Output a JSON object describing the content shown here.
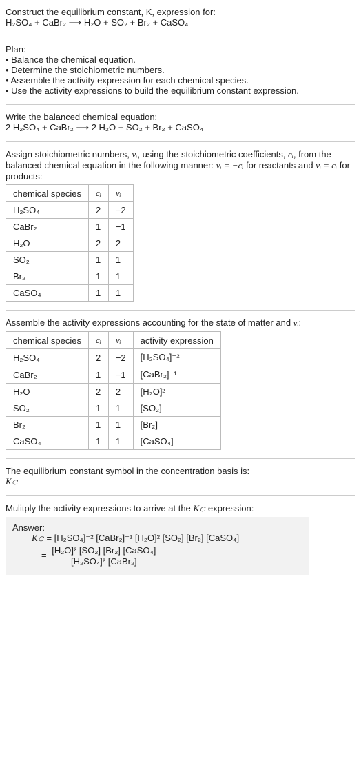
{
  "intro": {
    "line1": "Construct the equilibrium constant, K, expression for:",
    "equation": "H₂SO₄ + CaBr₂ ⟶ H₂O + SO₂ + Br₂ + CaSO₄"
  },
  "plan": {
    "title": "Plan:",
    "items": [
      "• Balance the chemical equation.",
      "• Determine the stoichiometric numbers.",
      "• Assemble the activity expression for each chemical species.",
      "• Use the activity expressions to build the equilibrium constant expression."
    ]
  },
  "balanced": {
    "title": "Write the balanced chemical equation:",
    "equation": "2 H₂SO₄ + CaBr₂ ⟶ 2 H₂O + SO₂ + Br₂ + CaSO₄"
  },
  "assign": {
    "text_a": "Assign stoichiometric numbers, ",
    "nu": "νᵢ",
    "text_b": ", using the stoichiometric coefficients, ",
    "ci": "cᵢ",
    "text_c": ", from the balanced chemical equation in the following manner: ",
    "rule1": "νᵢ = −cᵢ",
    "text_d": " for reactants and ",
    "rule2": "νᵢ = cᵢ",
    "text_e": " for products:"
  },
  "table1": {
    "headers": [
      "chemical species",
      "cᵢ",
      "νᵢ"
    ],
    "rows": [
      [
        "H₂SO₄",
        "2",
        "−2"
      ],
      [
        "CaBr₂",
        "1",
        "−1"
      ],
      [
        "H₂O",
        "2",
        "2"
      ],
      [
        "SO₂",
        "1",
        "1"
      ],
      [
        "Br₂",
        "1",
        "1"
      ],
      [
        "CaSO₄",
        "1",
        "1"
      ]
    ]
  },
  "assemble": {
    "text_a": "Assemble the activity expressions accounting for the state of matter and ",
    "nu": "νᵢ",
    "text_b": ":"
  },
  "table2": {
    "headers": [
      "chemical species",
      "cᵢ",
      "νᵢ",
      "activity expression"
    ],
    "rows": [
      [
        "H₂SO₄",
        "2",
        "−2",
        "[H₂SO₄]⁻²"
      ],
      [
        "CaBr₂",
        "1",
        "−1",
        "[CaBr₂]⁻¹"
      ],
      [
        "H₂O",
        "2",
        "2",
        "[H₂O]²"
      ],
      [
        "SO₂",
        "1",
        "1",
        "[SO₂]"
      ],
      [
        "Br₂",
        "1",
        "1",
        "[Br₂]"
      ],
      [
        "CaSO₄",
        "1",
        "1",
        "[CaSO₄]"
      ]
    ]
  },
  "symbol": {
    "line1": "The equilibrium constant symbol in the concentration basis is:",
    "kc": "K𝚌"
  },
  "multiply": {
    "text_a": "Mulitply the activity expressions to arrive at the ",
    "kc": "K𝚌",
    "text_b": " expression:"
  },
  "answer": {
    "label": "Answer:",
    "kc": "K𝚌",
    "eq": " = [H₂SO₄]⁻² [CaBr₂]⁻¹ [H₂O]² [SO₂] [Br₂] [CaSO₄]",
    "eq2_pre": "= ",
    "num": "[H₂O]² [SO₂] [Br₂] [CaSO₄]",
    "den": "[H₂SO₄]² [CaBr₂]"
  }
}
